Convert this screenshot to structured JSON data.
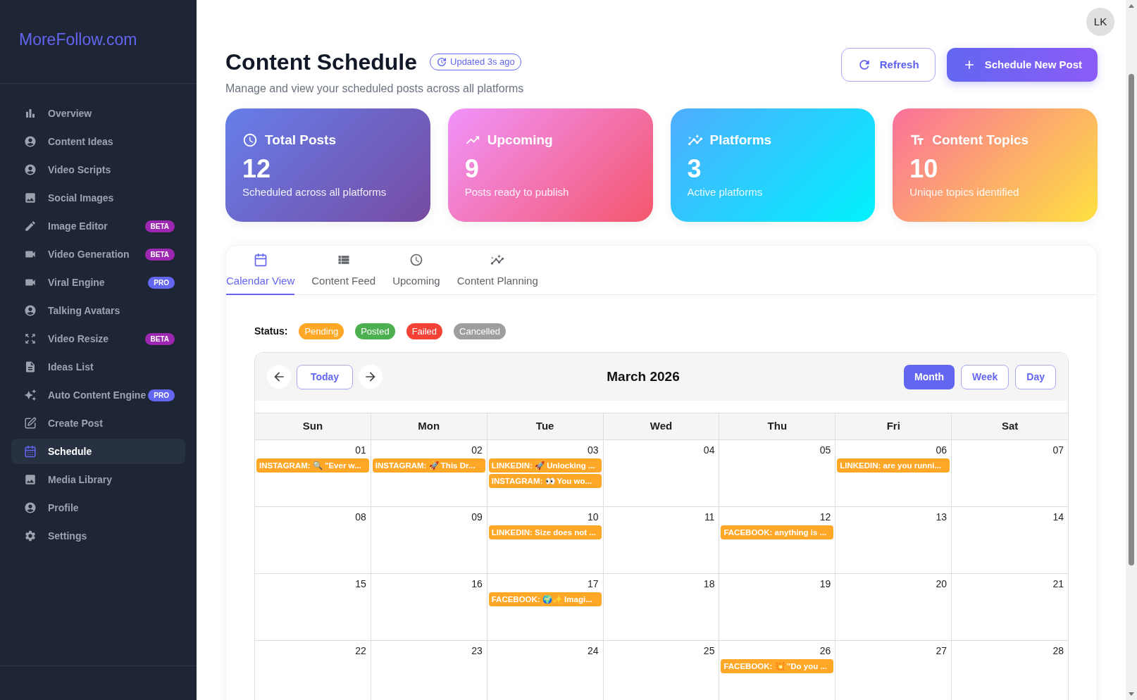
{
  "sidebar": {
    "logo": "MoreFollow.com",
    "items": [
      {
        "label": "Overview",
        "selected": false
      },
      {
        "label": "Content Ideas",
        "selected": false
      },
      {
        "label": "Video Scripts",
        "selected": false
      },
      {
        "label": "Social Images",
        "selected": false
      },
      {
        "label": "Image Editor",
        "selected": false,
        "badge": {
          "text": "BETA",
          "color": "#9c27b0"
        }
      },
      {
        "label": "Video Generation",
        "selected": false,
        "badge": {
          "text": "BETA",
          "color": "#9c27b0"
        }
      },
      {
        "label": "Viral Engine",
        "selected": false,
        "badge": {
          "text": "PRO",
          "color": "#6366f1"
        }
      },
      {
        "label": "Talking Avatars",
        "selected": false
      },
      {
        "label": "Video Resize",
        "selected": false,
        "badge": {
          "text": "BETA",
          "color": "#9c27b0"
        }
      },
      {
        "label": "Ideas List",
        "selected": false
      },
      {
        "label": "Auto Content Engine",
        "selected": false,
        "badge": {
          "text": "PRO",
          "color": "#6366f1"
        }
      },
      {
        "label": "Create Post",
        "selected": false
      },
      {
        "label": "Schedule",
        "selected": true
      },
      {
        "label": "Media Library",
        "selected": false
      },
      {
        "label": "Profile",
        "selected": false
      },
      {
        "label": "Settings",
        "selected": false
      }
    ]
  },
  "header": {
    "avatar": "LK",
    "title": "Content Schedule",
    "updated_badge": "Updated 3s ago",
    "subtitle": "Manage and view your scheduled posts across all platforms",
    "buttons": [
      {
        "label": "Refresh",
        "kind": "outline"
      },
      {
        "label": "Schedule New Post",
        "kind": "primary"
      }
    ]
  },
  "stats": [
    {
      "title": "Total Posts",
      "value": "12",
      "caption": "Scheduled across all platforms"
    },
    {
      "title": "Upcoming",
      "value": "9",
      "caption": "Posts ready to publish"
    },
    {
      "title": "Platforms",
      "value": "3",
      "caption": "Active platforms"
    },
    {
      "title": "Content Topics",
      "value": "10",
      "caption": "Unique topics identified"
    }
  ],
  "tabs": [
    {
      "label": "Calendar View",
      "selected": true
    },
    {
      "label": "Content Feed",
      "selected": false
    },
    {
      "label": "Upcoming",
      "selected": false
    },
    {
      "label": "Content Planning",
      "selected": false
    }
  ],
  "status_legend": {
    "label": "Status:",
    "items": [
      {
        "label": "Pending",
        "color": "#ffa726"
      },
      {
        "label": "Posted",
        "color": "#4caf50"
      },
      {
        "label": "Failed",
        "color": "#f44336"
      },
      {
        "label": "Cancelled",
        "color": "#9e9e9e"
      }
    ]
  },
  "calendar": {
    "today_button": "Today",
    "month_title": "March 2026",
    "views": [
      {
        "label": "Month",
        "selected": true
      },
      {
        "label": "Week",
        "selected": false
      },
      {
        "label": "Day",
        "selected": false
      }
    ],
    "weekdays": [
      "Sun",
      "Mon",
      "Tue",
      "Wed",
      "Thu",
      "Fri",
      "Sat"
    ],
    "weeks": [
      [
        {
          "date": "01",
          "events": [
            {
              "text": "INSTAGRAM: 🔍 \"Ever w...",
              "color": "#ffa726"
            }
          ]
        },
        {
          "date": "02",
          "events": [
            {
              "text": "INSTAGRAM: 🚀 This Dr...",
              "color": "#ffa726"
            }
          ]
        },
        {
          "date": "03",
          "events": [
            {
              "text": "LINKEDIN: 🚀 Unlocking ...",
              "color": "#ffa726"
            },
            {
              "text": "INSTAGRAM: 👀 You wo...",
              "color": "#ffa726"
            }
          ]
        },
        {
          "date": "04"
        },
        {
          "date": "05"
        },
        {
          "date": "06",
          "events": [
            {
              "text": "LINKEDIN: are you runni...",
              "color": "#ffa726"
            }
          ]
        },
        {
          "date": "07"
        }
      ],
      [
        {
          "date": "08"
        },
        {
          "date": "09"
        },
        {
          "date": "10",
          "events": [
            {
              "text": "LINKEDIN: Size does not ...",
              "color": "#ffa726"
            }
          ]
        },
        {
          "date": "11"
        },
        {
          "date": "12",
          "events": [
            {
              "text": "FACEBOOK: anything is ...",
              "color": "#ffa726"
            }
          ]
        },
        {
          "date": "13"
        },
        {
          "date": "14"
        }
      ],
      [
        {
          "date": "15"
        },
        {
          "date": "16"
        },
        {
          "date": "17",
          "events": [
            {
              "text": "FACEBOOK: 🌍✨ Imagi...",
              "color": "#ffa726"
            }
          ]
        },
        {
          "date": "18"
        },
        {
          "date": "19"
        },
        {
          "date": "20"
        },
        {
          "date": "21"
        }
      ],
      [
        {
          "date": "22"
        },
        {
          "date": "23"
        },
        {
          "date": "24"
        },
        {
          "date": "25"
        },
        {
          "date": "26",
          "events": [
            {
              "text": "FACEBOOK: 💥 \"Do you ...",
              "color": "#ffa726"
            }
          ]
        },
        {
          "date": "27"
        },
        {
          "date": "28"
        }
      ]
    ]
  }
}
